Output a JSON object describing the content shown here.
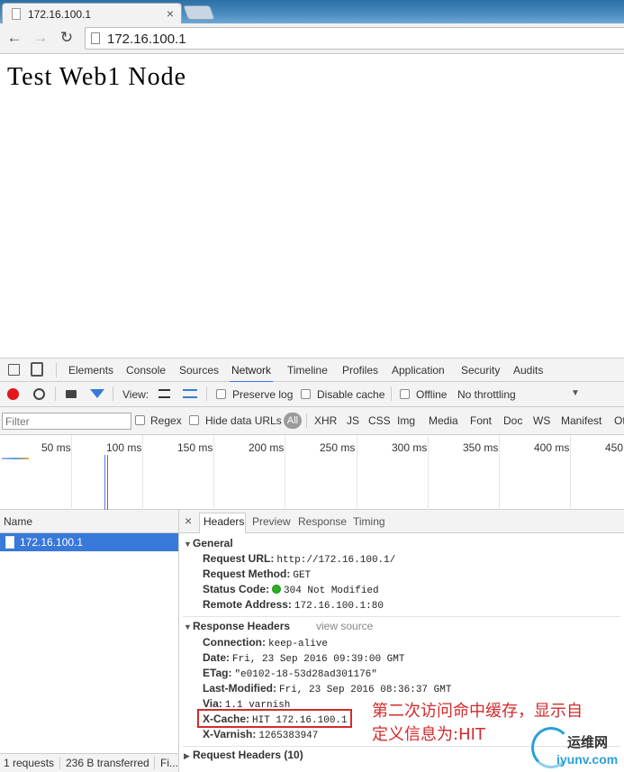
{
  "browser": {
    "tab_title": "172.16.100.1",
    "tab_close": "×",
    "url": "172.16.100.1",
    "back_glyph": "←",
    "forward_glyph": "→",
    "reload_glyph": "↻"
  },
  "page": {
    "heading": "Test Web1 Node"
  },
  "devtools": {
    "tabs": [
      "Elements",
      "Console",
      "Sources",
      "Network",
      "Timeline",
      "Profiles",
      "Application",
      "Security",
      "Audits"
    ],
    "active_tab": "Network",
    "network_toolbar": {
      "view_label": "View:",
      "preserve_log": "Preserve log",
      "disable_cache": "Disable cache",
      "offline": "Offline",
      "throttling": "No throttling",
      "throttling_caret": "▼"
    },
    "filter_bar": {
      "filter_placeholder": "Filter",
      "regex": "Regex",
      "hide_data_urls": "Hide data URLs",
      "types": [
        "All",
        "XHR",
        "JS",
        "CSS",
        "Img",
        "Media",
        "Font",
        "Doc",
        "WS",
        "Manifest",
        "Ot"
      ]
    },
    "timeline_labels": [
      "50 ms",
      "100 ms",
      "150 ms",
      "200 ms",
      "250 ms",
      "300 ms",
      "350 ms",
      "400 ms",
      "450"
    ],
    "requests": {
      "column_name": "Name",
      "rows": [
        {
          "name": "172.16.100.1"
        }
      ]
    },
    "status_bar": {
      "requests": "1 requests",
      "transferred": "236 B transferred",
      "finish": "Fi..."
    },
    "detail_tabs": [
      "Headers",
      "Preview",
      "Response",
      "Timing"
    ],
    "detail_close": "×",
    "general": {
      "title": "General",
      "rows": [
        {
          "key": "Request URL:",
          "value": "http://172.16.100.1/"
        },
        {
          "key": "Request Method:",
          "value": "GET"
        },
        {
          "key": "Status Code:",
          "value": "304 Not Modified"
        },
        {
          "key": "Remote Address:",
          "value": "172.16.100.1:80"
        }
      ]
    },
    "response_headers": {
      "title": "Response Headers",
      "view_source": "view source",
      "rows": [
        {
          "key": "Connection:",
          "value": "keep-alive"
        },
        {
          "key": "Date:",
          "value": "Fri, 23 Sep 2016 09:39:00 GMT"
        },
        {
          "key": "ETag:",
          "value": "\"e0102-18-53d28ad301176\""
        },
        {
          "key": "Last-Modified:",
          "value": "Fri, 23 Sep 2016 08:36:37 GMT"
        },
        {
          "key": "Via:",
          "value": "1.1 varnish"
        },
        {
          "key": "X-Cache:",
          "value": "HIT 172.16.100.1"
        },
        {
          "key": "X-Varnish:",
          "value": "1265383947"
        }
      ]
    },
    "request_headers": {
      "title": "Request Headers (10)"
    }
  },
  "annotation": {
    "line1": "第二次访问命中缓存，显示自",
    "line2": "定义信息为:HIT",
    "color": "#d42b2b"
  },
  "watermark": {
    "cn": "运维网",
    "en": "iyunv.com"
  }
}
